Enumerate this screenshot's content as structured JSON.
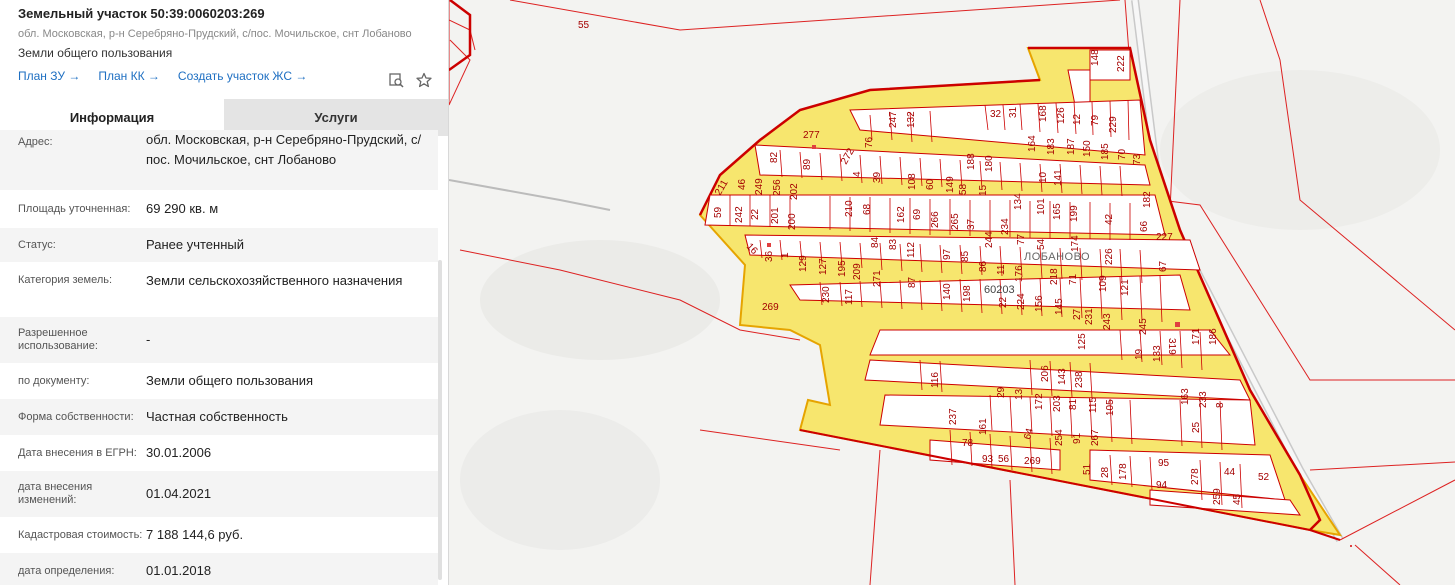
{
  "header": {
    "title": "Земельный участок 50:39:0060203:269",
    "address": "обл. Московская, р-н Серебряно-Прудский, с/пос. Мочильское, снт Лобаново",
    "usage": "Земли общего пользования",
    "links": [
      "План ЗУ →",
      "План КК →",
      "Создать участок ЖС →"
    ]
  },
  "tabs": [
    "Информация",
    "Услуги"
  ],
  "rows": [
    {
      "label": "Адрес:",
      "value": "обл. Московская, р-н Серебряно-Прудский, с/пос. Мочильское, снт Лобаново"
    },
    {
      "label": "Площадь уточненная:",
      "value": "69 290 кв. м"
    },
    {
      "label": "Статус:",
      "value": "Ранее учтенный"
    },
    {
      "label": "Категория земель:",
      "value": "Земли сельскохозяйственного назначения"
    },
    {
      "label": "Разрешенное использование:",
      "value": "-"
    },
    {
      "label": "по документу:",
      "value": "Земли общего пользования"
    },
    {
      "label": "Форма собственности:",
      "value": "Частная собственность"
    },
    {
      "label": "Дата внесения в ЕГРН:",
      "value": "30.01.2006"
    },
    {
      "label": "дата внесения изменений:",
      "value": "01.04.2021"
    },
    {
      "label": "Кадастровая стоимость:",
      "value": "7 188 144,6 руб."
    },
    {
      "label": "дата определения:",
      "value": "01.01.2018"
    }
  ],
  "map": {
    "block_label": "60203",
    "village_label": "ЛОБАНОВО",
    "area_label": "269",
    "outer_label": "55",
    "colors": {
      "highlight": "#f7e66e",
      "parcel_line": "#c00000",
      "outline": "#d60000"
    },
    "parcel_numbers": [
      {
        "t": "148"
      },
      {
        "t": "222"
      },
      {
        "t": "32"
      },
      {
        "t": "31"
      },
      {
        "t": "168"
      },
      {
        "t": "126"
      },
      {
        "t": "12"
      },
      {
        "t": "79"
      },
      {
        "t": "229"
      },
      {
        "t": "247"
      },
      {
        "t": "132"
      },
      {
        "t": "277"
      },
      {
        "t": "164"
      },
      {
        "t": "183"
      },
      {
        "t": "187"
      },
      {
        "t": "150"
      },
      {
        "t": "185"
      },
      {
        "t": "70"
      },
      {
        "t": "73"
      },
      {
        "t": "82"
      },
      {
        "t": "89"
      },
      {
        "t": "272"
      },
      {
        "t": "76"
      },
      {
        "t": "188"
      },
      {
        "t": "180"
      },
      {
        "t": "211"
      },
      {
        "t": "46"
      },
      {
        "t": "249"
      },
      {
        "t": "256"
      },
      {
        "t": "202"
      },
      {
        "t": "4"
      },
      {
        "t": "39"
      },
      {
        "t": "108"
      },
      {
        "t": "60"
      },
      {
        "t": "149"
      },
      {
        "t": "58"
      },
      {
        "t": "15"
      },
      {
        "t": "134"
      },
      {
        "t": "10"
      },
      {
        "t": "141"
      },
      {
        "t": "182"
      },
      {
        "t": "59"
      },
      {
        "t": "242"
      },
      {
        "t": "22"
      },
      {
        "t": "201"
      },
      {
        "t": "200"
      },
      {
        "t": "210"
      },
      {
        "t": "68"
      },
      {
        "t": "162"
      },
      {
        "t": "69"
      },
      {
        "t": "266"
      },
      {
        "t": "265"
      },
      {
        "t": "37"
      },
      {
        "t": "234"
      },
      {
        "t": "101"
      },
      {
        "t": "165"
      },
      {
        "t": "199"
      },
      {
        "t": "42"
      },
      {
        "t": "66"
      },
      {
        "t": "227"
      },
      {
        "t": "16"
      },
      {
        "t": "36"
      },
      {
        "t": "1"
      },
      {
        "t": "129"
      },
      {
        "t": "127"
      },
      {
        "t": "195"
      },
      {
        "t": "84"
      },
      {
        "t": "83"
      },
      {
        "t": "112"
      },
      {
        "t": "97"
      },
      {
        "t": "85"
      },
      {
        "t": "244"
      },
      {
        "t": "77"
      },
      {
        "t": "54"
      },
      {
        "t": "174"
      },
      {
        "t": "226"
      },
      {
        "t": "67"
      },
      {
        "t": "230"
      },
      {
        "t": "117"
      },
      {
        "t": "209"
      },
      {
        "t": "271"
      },
      {
        "t": "87"
      },
      {
        "t": "140"
      },
      {
        "t": "198"
      },
      {
        "t": "86"
      },
      {
        "t": "11"
      },
      {
        "t": "176"
      },
      {
        "t": "218"
      },
      {
        "t": "71"
      },
      {
        "t": "109"
      },
      {
        "t": "121"
      },
      {
        "t": "22"
      },
      {
        "t": "224"
      },
      {
        "t": "156"
      },
      {
        "t": "145"
      },
      {
        "t": "27"
      },
      {
        "t": "231"
      },
      {
        "t": "243"
      },
      {
        "t": "245"
      },
      {
        "t": "319"
      },
      {
        "t": "171"
      },
      {
        "t": "186"
      },
      {
        "t": "125"
      },
      {
        "t": "19"
      },
      {
        "t": "133"
      },
      {
        "t": "116"
      },
      {
        "t": "206"
      },
      {
        "t": "143"
      },
      {
        "t": "238"
      },
      {
        "t": "29"
      },
      {
        "t": "13"
      },
      {
        "t": "172"
      },
      {
        "t": "203"
      },
      {
        "t": "81"
      },
      {
        "t": "115"
      },
      {
        "t": "105"
      },
      {
        "t": "163"
      },
      {
        "t": "233"
      },
      {
        "t": "8"
      },
      {
        "t": "237"
      },
      {
        "t": "161"
      },
      {
        "t": "64"
      },
      {
        "t": "254"
      },
      {
        "t": "91"
      },
      {
        "t": "267"
      },
      {
        "t": "25"
      },
      {
        "t": "78"
      },
      {
        "t": "93"
      },
      {
        "t": "56"
      },
      {
        "t": "269"
      },
      {
        "t": "51"
      },
      {
        "t": "28"
      },
      {
        "t": "178"
      },
      {
        "t": "95"
      },
      {
        "t": "278"
      },
      {
        "t": "44"
      },
      {
        "t": "52"
      },
      {
        "t": "94"
      },
      {
        "t": "259"
      },
      {
        "t": "45"
      }
    ]
  }
}
